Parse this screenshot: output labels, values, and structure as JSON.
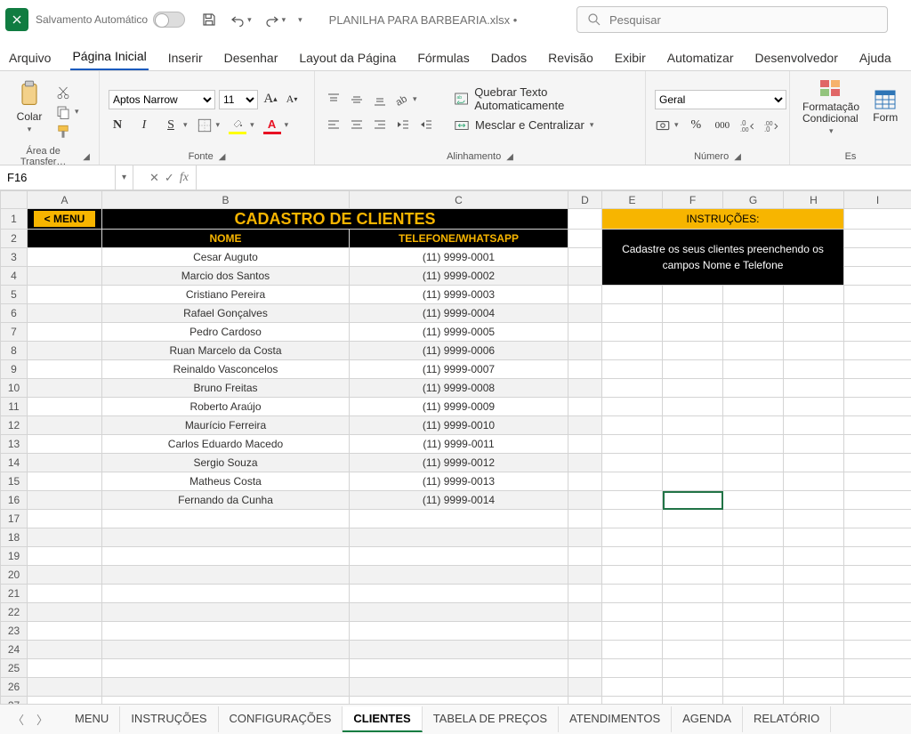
{
  "titlebar": {
    "autosave_label": "Salvamento Automático",
    "filename": "PLANILHA PARA BARBEARIA.xlsx  •",
    "search_placeholder": "Pesquisar"
  },
  "ribbon_tabs": [
    "Arquivo",
    "Página Inicial",
    "Inserir",
    "Desenhar",
    "Layout da Página",
    "Fórmulas",
    "Dados",
    "Revisão",
    "Exibir",
    "Automatizar",
    "Desenvolvedor",
    "Ajuda"
  ],
  "active_ribbon_tab": 1,
  "ribbon": {
    "clipboard": {
      "paste_label": "Colar",
      "group_label": "Área de Transfer…"
    },
    "font": {
      "font_name": "Aptos Narrow",
      "font_size": "11",
      "group_label": "Fonte",
      "bold": "N",
      "italic": "I",
      "under": "S"
    },
    "alignment": {
      "wrap_label": "Quebrar Texto Automaticamente",
      "merge_label": "Mesclar e Centralizar",
      "group_label": "Alinhamento"
    },
    "number": {
      "format": "Geral",
      "group_label": "Número"
    },
    "styles": {
      "condfmt_label": "Formatação Condicional",
      "fmttable_label": "Form",
      "group_label": "Es"
    }
  },
  "formula_bar": {
    "cell_ref": "F16",
    "formula": ""
  },
  "columns": [
    "A",
    "B",
    "C",
    "D",
    "E",
    "F",
    "G",
    "H",
    "I"
  ],
  "sheet": {
    "menu_button": "< MENU",
    "title": "CADASTRO DE CLIENTES",
    "headers": {
      "col_b": "NOME",
      "col_c": "TELEFONE/WHATSAPP"
    },
    "instr_title": "INSTRUÇÕES:",
    "instr_body": "Cadastre os seus clientes preenchendo os campos Nome e Telefone",
    "rows": [
      {
        "nome": "Cesar Auguto",
        "tel": "(11) 9999-0001"
      },
      {
        "nome": "Marcio dos Santos",
        "tel": "(11) 9999-0002"
      },
      {
        "nome": "Cristiano Pereira",
        "tel": "(11) 9999-0003"
      },
      {
        "nome": "Rafael Gonçalves",
        "tel": "(11) 9999-0004"
      },
      {
        "nome": "Pedro Cardoso",
        "tel": "(11) 9999-0005"
      },
      {
        "nome": "Ruan Marcelo da Costa",
        "tel": "(11) 9999-0006"
      },
      {
        "nome": "Reinaldo Vasconcelos",
        "tel": "(11) 9999-0007"
      },
      {
        "nome": "Bruno Freitas",
        "tel": "(11) 9999-0008"
      },
      {
        "nome": "Roberto Araújo",
        "tel": "(11) 9999-0009"
      },
      {
        "nome": "Maurício Ferreira",
        "tel": "(11) 9999-0010"
      },
      {
        "nome": "Carlos Eduardo Macedo",
        "tel": "(11) 9999-0011"
      },
      {
        "nome": "Sergio Souza",
        "tel": "(11) 9999-0012"
      },
      {
        "nome": "Matheus Costa",
        "tel": "(11) 9999-0013"
      },
      {
        "nome": "Fernando da Cunha",
        "tel": "(11) 9999-0014"
      }
    ],
    "blank_row_count": 11,
    "first_data_row": 3
  },
  "sheet_tabs": [
    "MENU",
    "INSTRUÇÕES",
    "CONFIGURAÇÕES",
    "CLIENTES",
    "TABELA DE PREÇOS",
    "ATENDIMENTOS",
    "AGENDA",
    "RELATÓRIO"
  ],
  "active_sheet_tab": 3
}
